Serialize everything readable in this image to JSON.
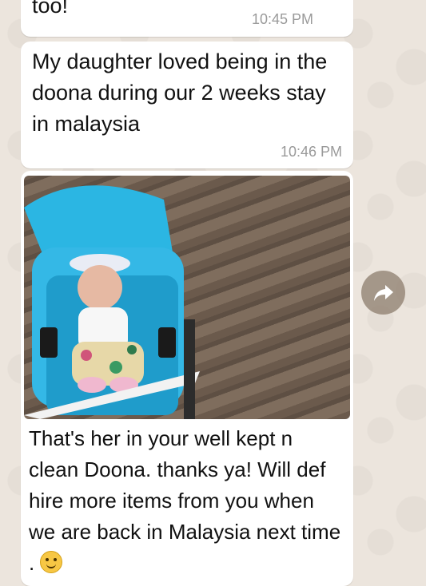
{
  "messages": [
    {
      "text": "too!",
      "time": "10:45 PM"
    },
    {
      "text": "My daughter loved being in the doona during our 2 weeks stay in malaysia",
      "time": "10:46 PM"
    },
    {
      "caption": "That's her in your well kept n clean Doona. thanks ya! Will def hire more items from you when we are back in Malaysia next time .",
      "emoji": "smiling-face"
    }
  ],
  "colors": {
    "chat_bg": "#ece5dd",
    "bubble": "#ffffff",
    "time": "#9a9a9a",
    "forward_button": "#8c7c6c"
  },
  "icons": {
    "forward": "forward-arrow-icon"
  }
}
